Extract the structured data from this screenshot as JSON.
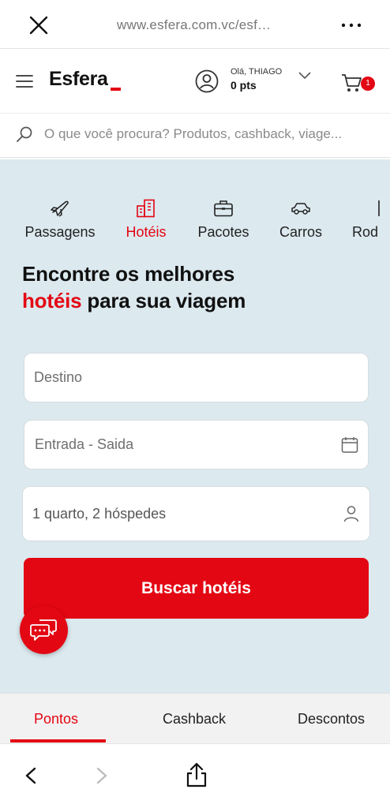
{
  "browser": {
    "url": "www.esfera.com.vc/esf…",
    "icons": {
      "close": "close-icon",
      "more": "more-dots-icon"
    }
  },
  "header": {
    "logo": "Esfera",
    "greeting": "Olá, THIAGO",
    "points": "0 pts",
    "cart_count": "1",
    "icons": {
      "menu": "hamburger-icon",
      "user": "user-icon",
      "dropdown": "chevron-down-icon",
      "cart": "cart-icon"
    }
  },
  "search": {
    "placeholder": "O que você procura? Produtos, cashback, viage..."
  },
  "tabs": [
    {
      "label": "Passagens",
      "icon": "plane-icon",
      "active": false
    },
    {
      "label": "Hotéis",
      "icon": "hotel-icon",
      "active": true
    },
    {
      "label": "Pacotes",
      "icon": "suitcase-icon",
      "active": false
    },
    {
      "label": "Carros",
      "icon": "car-icon",
      "active": false
    },
    {
      "label": "Rod",
      "icon": "bus-icon",
      "active": false
    }
  ],
  "headline": {
    "line1": "Encontre os melhores",
    "accent": "hotéis",
    "line2_rest": " para sua viagem"
  },
  "form": {
    "destination_placeholder": "Destino",
    "dates_placeholder": "Entrada - Saida",
    "guests_value": "1 quarto, 2 hóspedes",
    "submit_label": "Buscar hotéis"
  },
  "bottom_tabs": [
    {
      "label": "Pontos",
      "active": true
    },
    {
      "label": "Cashback",
      "active": false
    },
    {
      "label": "Descontos",
      "active": false
    }
  ],
  "colors": {
    "brand_red": "#e30613",
    "panel_bg": "#dce9ef"
  }
}
